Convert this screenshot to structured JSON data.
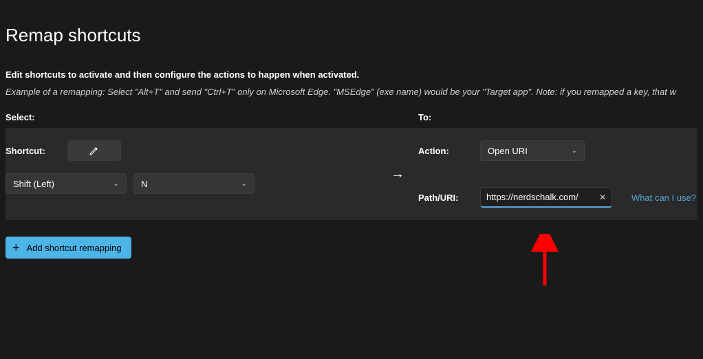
{
  "page": {
    "title": "Remap shortcuts",
    "description": "Edit shortcuts to activate and then configure the actions to happen when activated.",
    "example": "Example of a remapping: Select \"Alt+T\" and send \"Ctrl+T\" only on Microsoft Edge. \"MSEdge\" (exe name) would be your \"Target app\". Note: if you remapped a key, that w"
  },
  "headers": {
    "select": "Select:",
    "to": "To:"
  },
  "labels": {
    "shortcut": "Shortcut:",
    "action": "Action:",
    "path_uri": "Path/URI:"
  },
  "shortcut": {
    "key1": "Shift (Left)",
    "key2": "N"
  },
  "action": {
    "selected": "Open URI"
  },
  "uri": {
    "value": "https://nerdschalk.com/"
  },
  "help_link": "What can I use?",
  "add_button": "Add shortcut remapping",
  "arrow_glyph": "→",
  "annotation_arrow_color": "#ff0000"
}
